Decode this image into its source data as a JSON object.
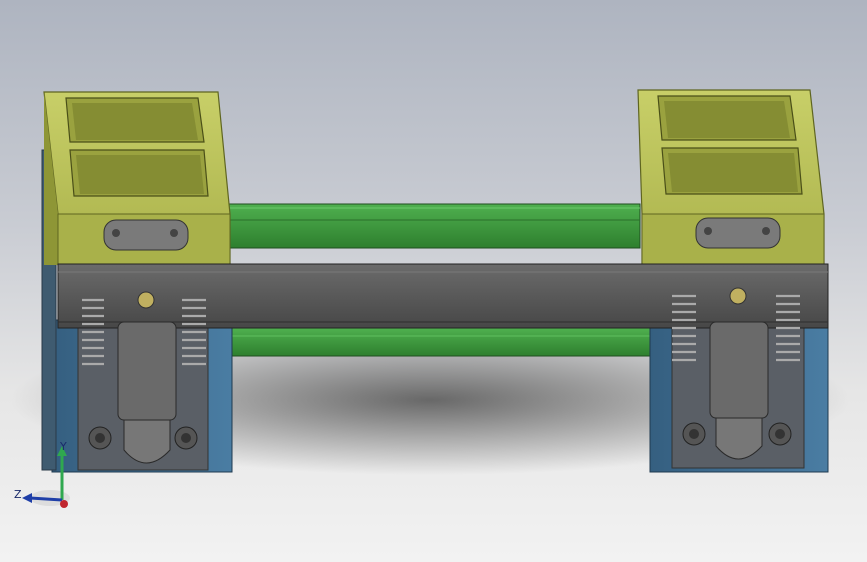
{
  "viewport": {
    "background_top": "#aeb4c0",
    "background_bottom": "#f2f2f2"
  },
  "model": {
    "colors": {
      "fixture_yellow": "#b7bf55",
      "fixture_yellow_dark": "#8e9636",
      "fixture_yellow_light": "#cfd57a",
      "rail_green": "#3f9b3f",
      "rail_green_dark": "#2a6f2a",
      "beam_gray": "#5d5d5d",
      "beam_gray_dark": "#3a3a3a",
      "base_blue": "#3f6f93",
      "base_blue_dark": "#284b66",
      "clamp_gray": "#6a6a6a",
      "spring_gray": "#9a9a9a"
    }
  },
  "triad": {
    "y_label": "Y",
    "z_label": "Z",
    "y_color": "#2fa84f",
    "z_color": "#1f3fa8",
    "x_color": "#c0262e"
  }
}
